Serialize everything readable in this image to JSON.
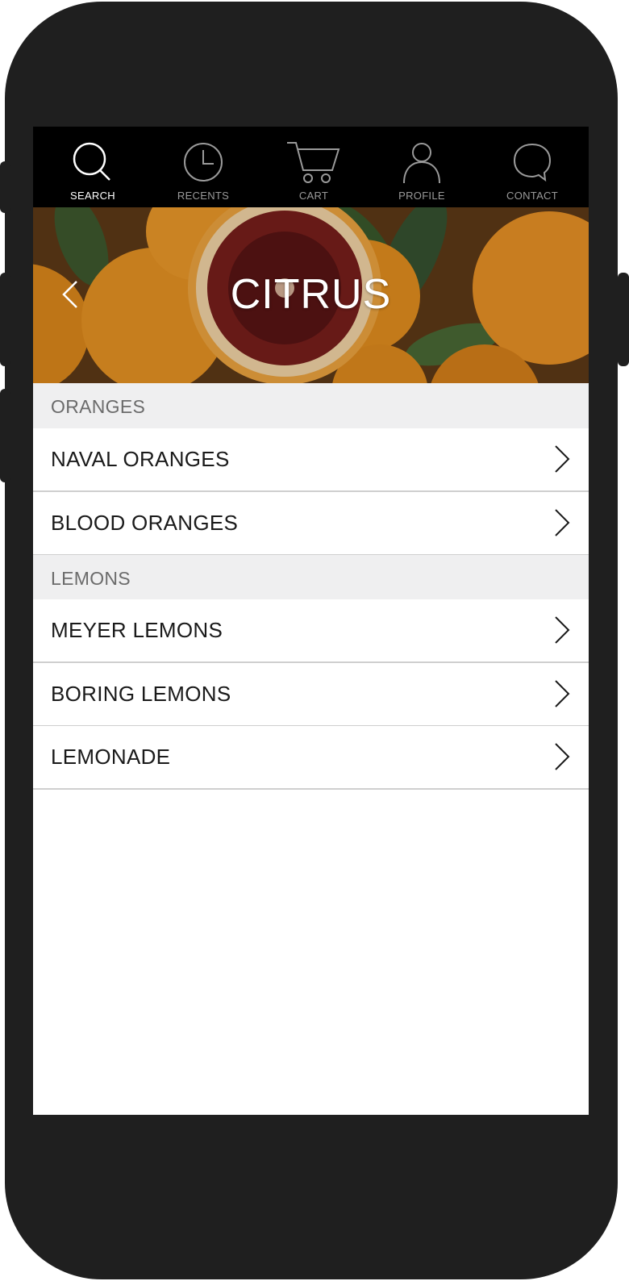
{
  "tabbar": {
    "tabs": [
      {
        "label": "SEARCH",
        "icon": "search-icon",
        "active": true
      },
      {
        "label": "RECENTS",
        "icon": "clock-icon",
        "active": false
      },
      {
        "label": "CART",
        "icon": "cart-icon",
        "active": false
      },
      {
        "label": "PROFILE",
        "icon": "person-icon",
        "active": false
      },
      {
        "label": "CONTACT",
        "icon": "chat-bubble-icon",
        "active": false
      }
    ]
  },
  "hero": {
    "title": "CITRUS",
    "back_icon": "chevron-left-icon"
  },
  "sections": [
    {
      "title": "ORANGES",
      "items": [
        "NAVAL ORANGES",
        "BLOOD ORANGES"
      ]
    },
    {
      "title": "LEMONS",
      "items": [
        "MEYER LEMONS",
        "BORING LEMONS",
        "LEMONADE"
      ]
    }
  ],
  "colors": {
    "tabbar_bg": "#000000",
    "section_bg": "#efeff0",
    "phone_frame": "#1f1f1f"
  }
}
